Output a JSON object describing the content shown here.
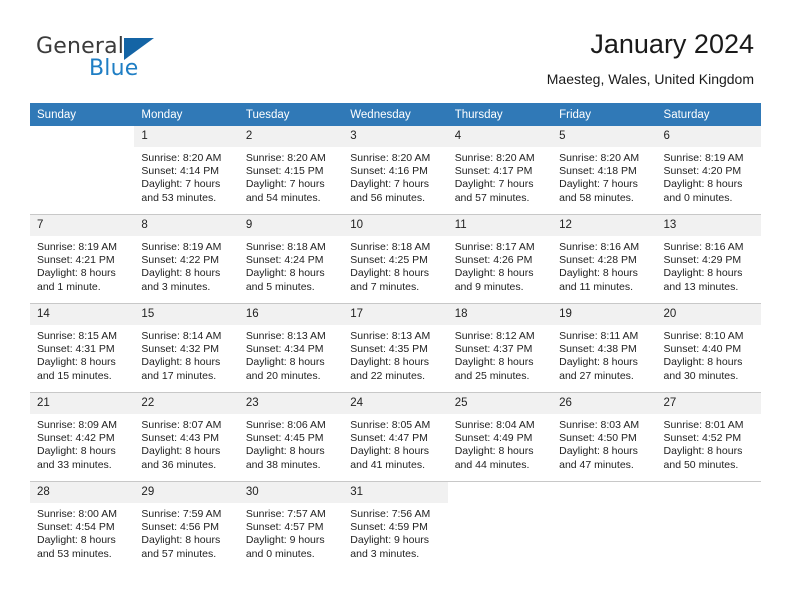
{
  "brand": {
    "name_top": "General",
    "name_bottom": "Blue",
    "triangle_color": "#1464a5",
    "blue_color": "#1f7ec4",
    "gray_color": "#3b3b3b"
  },
  "header": {
    "title": "January 2024",
    "location": "Maesteg, Wales, United Kingdom"
  },
  "theme": {
    "header_row_bg": "#3079b7",
    "header_row_text": "#ffffff",
    "daynum_bg": "#f1f1f1",
    "grid_line": "#c8c8c8"
  },
  "weekday_headers": [
    "Sunday",
    "Monday",
    "Tuesday",
    "Wednesday",
    "Thursday",
    "Friday",
    "Saturday"
  ],
  "weeks": [
    [
      {
        "day": "",
        "sunrise": "",
        "sunset": "",
        "daylight_line1": "",
        "daylight_line2": ""
      },
      {
        "day": "1",
        "sunrise": "Sunrise: 8:20 AM",
        "sunset": "Sunset: 4:14 PM",
        "daylight_line1": "Daylight: 7 hours",
        "daylight_line2": "and 53 minutes."
      },
      {
        "day": "2",
        "sunrise": "Sunrise: 8:20 AM",
        "sunset": "Sunset: 4:15 PM",
        "daylight_line1": "Daylight: 7 hours",
        "daylight_line2": "and 54 minutes."
      },
      {
        "day": "3",
        "sunrise": "Sunrise: 8:20 AM",
        "sunset": "Sunset: 4:16 PM",
        "daylight_line1": "Daylight: 7 hours",
        "daylight_line2": "and 56 minutes."
      },
      {
        "day": "4",
        "sunrise": "Sunrise: 8:20 AM",
        "sunset": "Sunset: 4:17 PM",
        "daylight_line1": "Daylight: 7 hours",
        "daylight_line2": "and 57 minutes."
      },
      {
        "day": "5",
        "sunrise": "Sunrise: 8:20 AM",
        "sunset": "Sunset: 4:18 PM",
        "daylight_line1": "Daylight: 7 hours",
        "daylight_line2": "and 58 minutes."
      },
      {
        "day": "6",
        "sunrise": "Sunrise: 8:19 AM",
        "sunset": "Sunset: 4:20 PM",
        "daylight_line1": "Daylight: 8 hours",
        "daylight_line2": "and 0 minutes."
      }
    ],
    [
      {
        "day": "7",
        "sunrise": "Sunrise: 8:19 AM",
        "sunset": "Sunset: 4:21 PM",
        "daylight_line1": "Daylight: 8 hours",
        "daylight_line2": "and 1 minute."
      },
      {
        "day": "8",
        "sunrise": "Sunrise: 8:19 AM",
        "sunset": "Sunset: 4:22 PM",
        "daylight_line1": "Daylight: 8 hours",
        "daylight_line2": "and 3 minutes."
      },
      {
        "day": "9",
        "sunrise": "Sunrise: 8:18 AM",
        "sunset": "Sunset: 4:24 PM",
        "daylight_line1": "Daylight: 8 hours",
        "daylight_line2": "and 5 minutes."
      },
      {
        "day": "10",
        "sunrise": "Sunrise: 8:18 AM",
        "sunset": "Sunset: 4:25 PM",
        "daylight_line1": "Daylight: 8 hours",
        "daylight_line2": "and 7 minutes."
      },
      {
        "day": "11",
        "sunrise": "Sunrise: 8:17 AM",
        "sunset": "Sunset: 4:26 PM",
        "daylight_line1": "Daylight: 8 hours",
        "daylight_line2": "and 9 minutes."
      },
      {
        "day": "12",
        "sunrise": "Sunrise: 8:16 AM",
        "sunset": "Sunset: 4:28 PM",
        "daylight_line1": "Daylight: 8 hours",
        "daylight_line2": "and 11 minutes."
      },
      {
        "day": "13",
        "sunrise": "Sunrise: 8:16 AM",
        "sunset": "Sunset: 4:29 PM",
        "daylight_line1": "Daylight: 8 hours",
        "daylight_line2": "and 13 minutes."
      }
    ],
    [
      {
        "day": "14",
        "sunrise": "Sunrise: 8:15 AM",
        "sunset": "Sunset: 4:31 PM",
        "daylight_line1": "Daylight: 8 hours",
        "daylight_line2": "and 15 minutes."
      },
      {
        "day": "15",
        "sunrise": "Sunrise: 8:14 AM",
        "sunset": "Sunset: 4:32 PM",
        "daylight_line1": "Daylight: 8 hours",
        "daylight_line2": "and 17 minutes."
      },
      {
        "day": "16",
        "sunrise": "Sunrise: 8:13 AM",
        "sunset": "Sunset: 4:34 PM",
        "daylight_line1": "Daylight: 8 hours",
        "daylight_line2": "and 20 minutes."
      },
      {
        "day": "17",
        "sunrise": "Sunrise: 8:13 AM",
        "sunset": "Sunset: 4:35 PM",
        "daylight_line1": "Daylight: 8 hours",
        "daylight_line2": "and 22 minutes."
      },
      {
        "day": "18",
        "sunrise": "Sunrise: 8:12 AM",
        "sunset": "Sunset: 4:37 PM",
        "daylight_line1": "Daylight: 8 hours",
        "daylight_line2": "and 25 minutes."
      },
      {
        "day": "19",
        "sunrise": "Sunrise: 8:11 AM",
        "sunset": "Sunset: 4:38 PM",
        "daylight_line1": "Daylight: 8 hours",
        "daylight_line2": "and 27 minutes."
      },
      {
        "day": "20",
        "sunrise": "Sunrise: 8:10 AM",
        "sunset": "Sunset: 4:40 PM",
        "daylight_line1": "Daylight: 8 hours",
        "daylight_line2": "and 30 minutes."
      }
    ],
    [
      {
        "day": "21",
        "sunrise": "Sunrise: 8:09 AM",
        "sunset": "Sunset: 4:42 PM",
        "daylight_line1": "Daylight: 8 hours",
        "daylight_line2": "and 33 minutes."
      },
      {
        "day": "22",
        "sunrise": "Sunrise: 8:07 AM",
        "sunset": "Sunset: 4:43 PM",
        "daylight_line1": "Daylight: 8 hours",
        "daylight_line2": "and 36 minutes."
      },
      {
        "day": "23",
        "sunrise": "Sunrise: 8:06 AM",
        "sunset": "Sunset: 4:45 PM",
        "daylight_line1": "Daylight: 8 hours",
        "daylight_line2": "and 38 minutes."
      },
      {
        "day": "24",
        "sunrise": "Sunrise: 8:05 AM",
        "sunset": "Sunset: 4:47 PM",
        "daylight_line1": "Daylight: 8 hours",
        "daylight_line2": "and 41 minutes."
      },
      {
        "day": "25",
        "sunrise": "Sunrise: 8:04 AM",
        "sunset": "Sunset: 4:49 PM",
        "daylight_line1": "Daylight: 8 hours",
        "daylight_line2": "and 44 minutes."
      },
      {
        "day": "26",
        "sunrise": "Sunrise: 8:03 AM",
        "sunset": "Sunset: 4:50 PM",
        "daylight_line1": "Daylight: 8 hours",
        "daylight_line2": "and 47 minutes."
      },
      {
        "day": "27",
        "sunrise": "Sunrise: 8:01 AM",
        "sunset": "Sunset: 4:52 PM",
        "daylight_line1": "Daylight: 8 hours",
        "daylight_line2": "and 50 minutes."
      }
    ],
    [
      {
        "day": "28",
        "sunrise": "Sunrise: 8:00 AM",
        "sunset": "Sunset: 4:54 PM",
        "daylight_line1": "Daylight: 8 hours",
        "daylight_line2": "and 53 minutes."
      },
      {
        "day": "29",
        "sunrise": "Sunrise: 7:59 AM",
        "sunset": "Sunset: 4:56 PM",
        "daylight_line1": "Daylight: 8 hours",
        "daylight_line2": "and 57 minutes."
      },
      {
        "day": "30",
        "sunrise": "Sunrise: 7:57 AM",
        "sunset": "Sunset: 4:57 PM",
        "daylight_line1": "Daylight: 9 hours",
        "daylight_line2": "and 0 minutes."
      },
      {
        "day": "31",
        "sunrise": "Sunrise: 7:56 AM",
        "sunset": "Sunset: 4:59 PM",
        "daylight_line1": "Daylight: 9 hours",
        "daylight_line2": "and 3 minutes."
      },
      {
        "day": "",
        "sunrise": "",
        "sunset": "",
        "daylight_line1": "",
        "daylight_line2": ""
      },
      {
        "day": "",
        "sunrise": "",
        "sunset": "",
        "daylight_line1": "",
        "daylight_line2": ""
      },
      {
        "day": "",
        "sunrise": "",
        "sunset": "",
        "daylight_line1": "",
        "daylight_line2": ""
      }
    ]
  ]
}
